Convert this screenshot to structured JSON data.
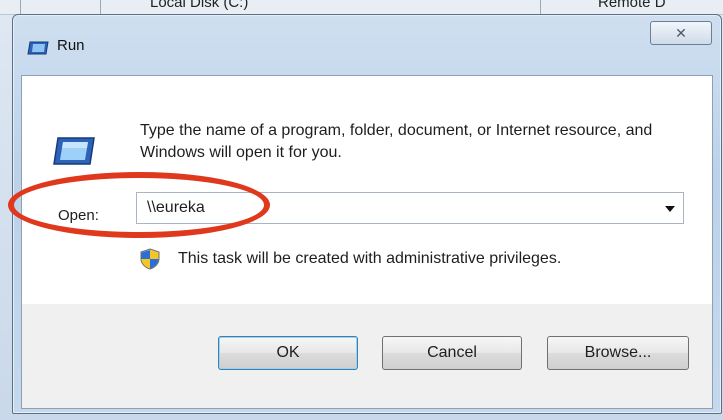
{
  "background": {
    "left_text": "Local Disk (C:)",
    "right_text": "Remote D"
  },
  "dialog": {
    "title": "Run",
    "close_symbol": "✕",
    "description": "Type the name of a program, folder, document, or Internet resource, and Windows will open it for you.",
    "open_label": "Open:",
    "open_value": "\\\\eureka",
    "admin_note": "This task will be created with administrative privileges.",
    "buttons": {
      "ok": "OK",
      "cancel": "Cancel",
      "browse": "Browse..."
    }
  },
  "colors": {
    "highlight_oval": "#e0381c",
    "default_button_border": "#3c7fb1"
  },
  "icons": {
    "title": "run-icon",
    "main": "run-icon",
    "shield": "uac-shield-icon",
    "dropdown": "chevron-down-icon"
  }
}
